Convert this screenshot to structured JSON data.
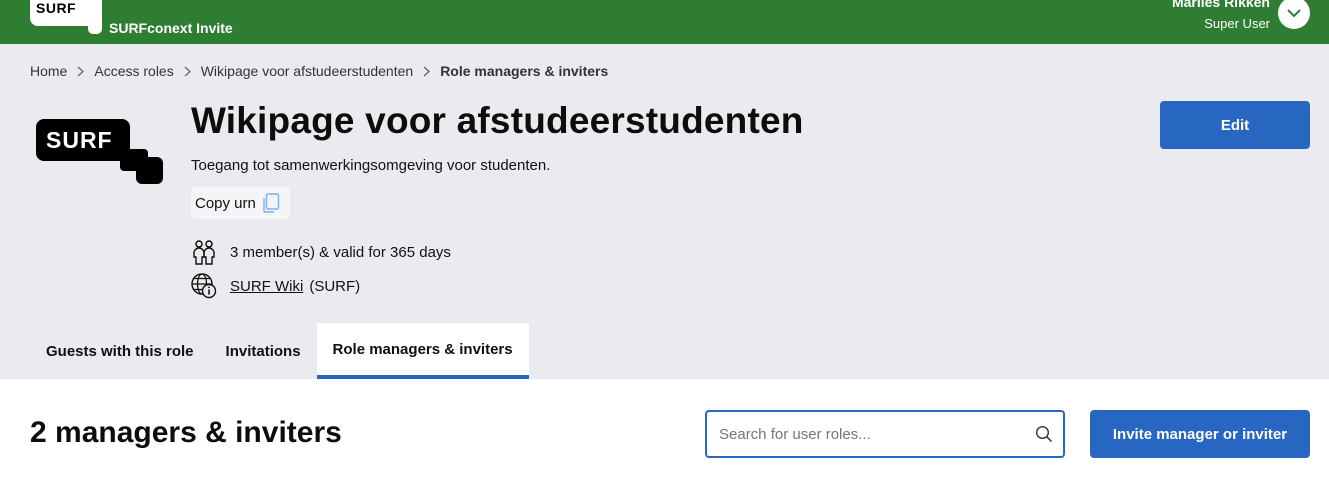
{
  "topbar": {
    "logo_text": "SURF",
    "app_title": "SURFconext Invite",
    "user_name": "Marlies Rikken",
    "user_role": "Super User"
  },
  "breadcrumb": {
    "items": [
      "Home",
      "Access roles",
      "Wikipage voor afstudeerstudenten"
    ],
    "current": "Role managers & inviters"
  },
  "role": {
    "logo_text": "SURF",
    "title": "Wikipage voor afstudeerstudenten",
    "description": "Toegang tot samenwerkingsomgeving voor studenten.",
    "copy_urn_label": "Copy urn",
    "members_text": "3 member(s) & valid for 365 days",
    "app_link": "SURF Wiki",
    "app_org": "(SURF)",
    "edit_label": "Edit"
  },
  "tabs": [
    {
      "label": "Guests with this role",
      "active": false
    },
    {
      "label": "Invitations",
      "active": false
    },
    {
      "label": "Role managers & inviters",
      "active": true
    }
  ],
  "content": {
    "title": "2 managers & inviters",
    "search_placeholder": "Search for user roles...",
    "invite_label": "Invite manager or inviter"
  },
  "colors": {
    "topbar": "#2e7d32",
    "primary": "#2767c1",
    "header_bg": "#eaebef"
  }
}
